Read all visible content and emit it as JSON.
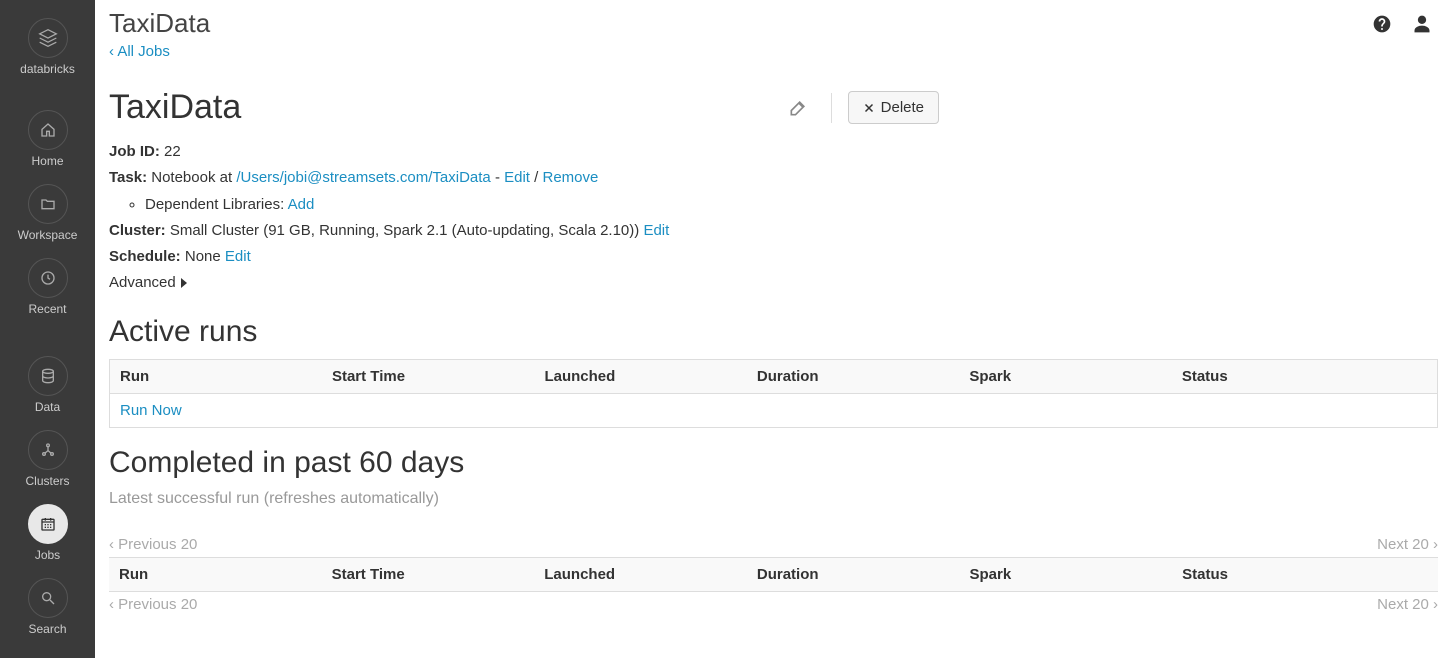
{
  "brand": "databricks",
  "sidebar": {
    "items": [
      {
        "id": "home",
        "label": "Home"
      },
      {
        "id": "workspace",
        "label": "Workspace"
      },
      {
        "id": "recent",
        "label": "Recent"
      },
      {
        "id": "data",
        "label": "Data"
      },
      {
        "id": "clusters",
        "label": "Clusters"
      },
      {
        "id": "jobs",
        "label": "Jobs"
      },
      {
        "id": "search",
        "label": "Search"
      }
    ]
  },
  "topbar": {
    "title": "TaxiData"
  },
  "breadcrumb": {
    "all_jobs": "‹ All Jobs"
  },
  "job": {
    "title": "TaxiData",
    "delete_label": "Delete",
    "id_label": "Job ID:",
    "id_value": "22",
    "task_label": "Task:",
    "task_prefix": "Notebook at ",
    "task_path": "/Users/jobi@streamsets.com/TaxiData",
    "task_sep1": " - ",
    "task_edit": "Edit",
    "task_sep2": " / ",
    "task_remove": "Remove",
    "deps_label": "Dependent Libraries: ",
    "deps_add": "Add",
    "cluster_label": "Cluster:",
    "cluster_value": "Small Cluster (91 GB, Running, Spark 2.1 (Auto-updating, Scala 2.10))",
    "cluster_edit": "Edit",
    "schedule_label": "Schedule:",
    "schedule_value": "None",
    "schedule_edit": "Edit",
    "advanced": "Advanced"
  },
  "active": {
    "title": "Active runs",
    "headers": [
      "Run",
      "Start Time",
      "Launched",
      "Duration",
      "Spark",
      "Status"
    ],
    "run_now": "Run Now"
  },
  "completed": {
    "title": "Completed in past 60 days",
    "refresh_note": "Latest successful run (refreshes automatically)",
    "headers": [
      "Run",
      "Start Time",
      "Launched",
      "Duration",
      "Spark",
      "Status"
    ],
    "prev": "‹ Previous 20",
    "next": "Next 20 ›"
  }
}
